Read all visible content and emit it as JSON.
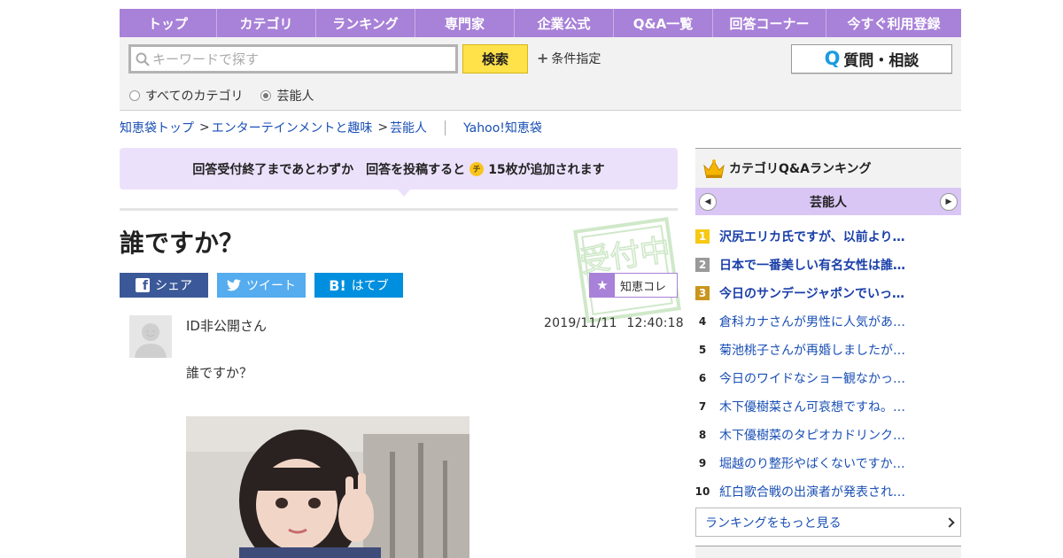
{
  "nav": {
    "items": [
      "トップ",
      "カテゴリ",
      "ランキング",
      "専門家",
      "企業公式",
      "Q&A一覧",
      "回答コーナー",
      "今すぐ利用登録"
    ]
  },
  "search": {
    "placeholder": "キーワードで探す",
    "button_label": "検索",
    "condition_label": "条件指定",
    "ask_label": "質問・相談",
    "scope_all": "すべてのカテゴリ",
    "scope_current": "芸能人",
    "scope_selected": "芸能人"
  },
  "breadcrumb": {
    "items": [
      "知恵袋トップ",
      "エンターテインメントと趣味",
      "芸能人"
    ],
    "separator": ">",
    "site_link": "Yahoo!知恵袋"
  },
  "notice": {
    "text_before": "回答受付終了まであとわずか　回答を投稿すると",
    "coin_label": "チ",
    "text_after": "15枚が追加されます"
  },
  "question": {
    "title": "誰ですか？",
    "stamp_text": "受付中",
    "share": {
      "facebook": "シェア",
      "twitter": "ツイート",
      "hatena": "はてブ",
      "hatena_icon": "B!"
    },
    "collect_label": "知恵コレ",
    "author": "ID非公開さん",
    "date": "2019/11/11",
    "time": "12:40:18",
    "body": "誰ですか？"
  },
  "ranking": {
    "title": "カテゴリQ&Aランキング",
    "category": "芸能人",
    "items": [
      {
        "rank": "1",
        "text": "沢尻エリカ氏ですが、以前より…"
      },
      {
        "rank": "2",
        "text": "日本で一番美しい有名女性は誰…"
      },
      {
        "rank": "3",
        "text": "今日のサンデージャポンでいっ…"
      },
      {
        "rank": "4",
        "text": "倉科カナさんが男性に人気があ…"
      },
      {
        "rank": "5",
        "text": "菊池桃子さんが再婚しましたが…"
      },
      {
        "rank": "6",
        "text": "今日のワイドなショー観なかっ…"
      },
      {
        "rank": "7",
        "text": "木下優樹菜さん可哀想ですね。…"
      },
      {
        "rank": "8",
        "text": "木下優樹菜のタピオカドリンク…"
      },
      {
        "rank": "9",
        "text": "堀越のり整形やばくないですか…"
      },
      {
        "rank": "10",
        "text": "紅白歌合戦の出演者が発表され…"
      }
    ],
    "more_label": "ランキングをもっと見る"
  },
  "colors": {
    "accent": "#a881d8",
    "notice_bg": "#ece1fb",
    "search_button": "#ffe14a",
    "link": "#1a4fb5",
    "facebook": "#3b5998",
    "twitter": "#55acee",
    "hatena": "#008fde"
  }
}
